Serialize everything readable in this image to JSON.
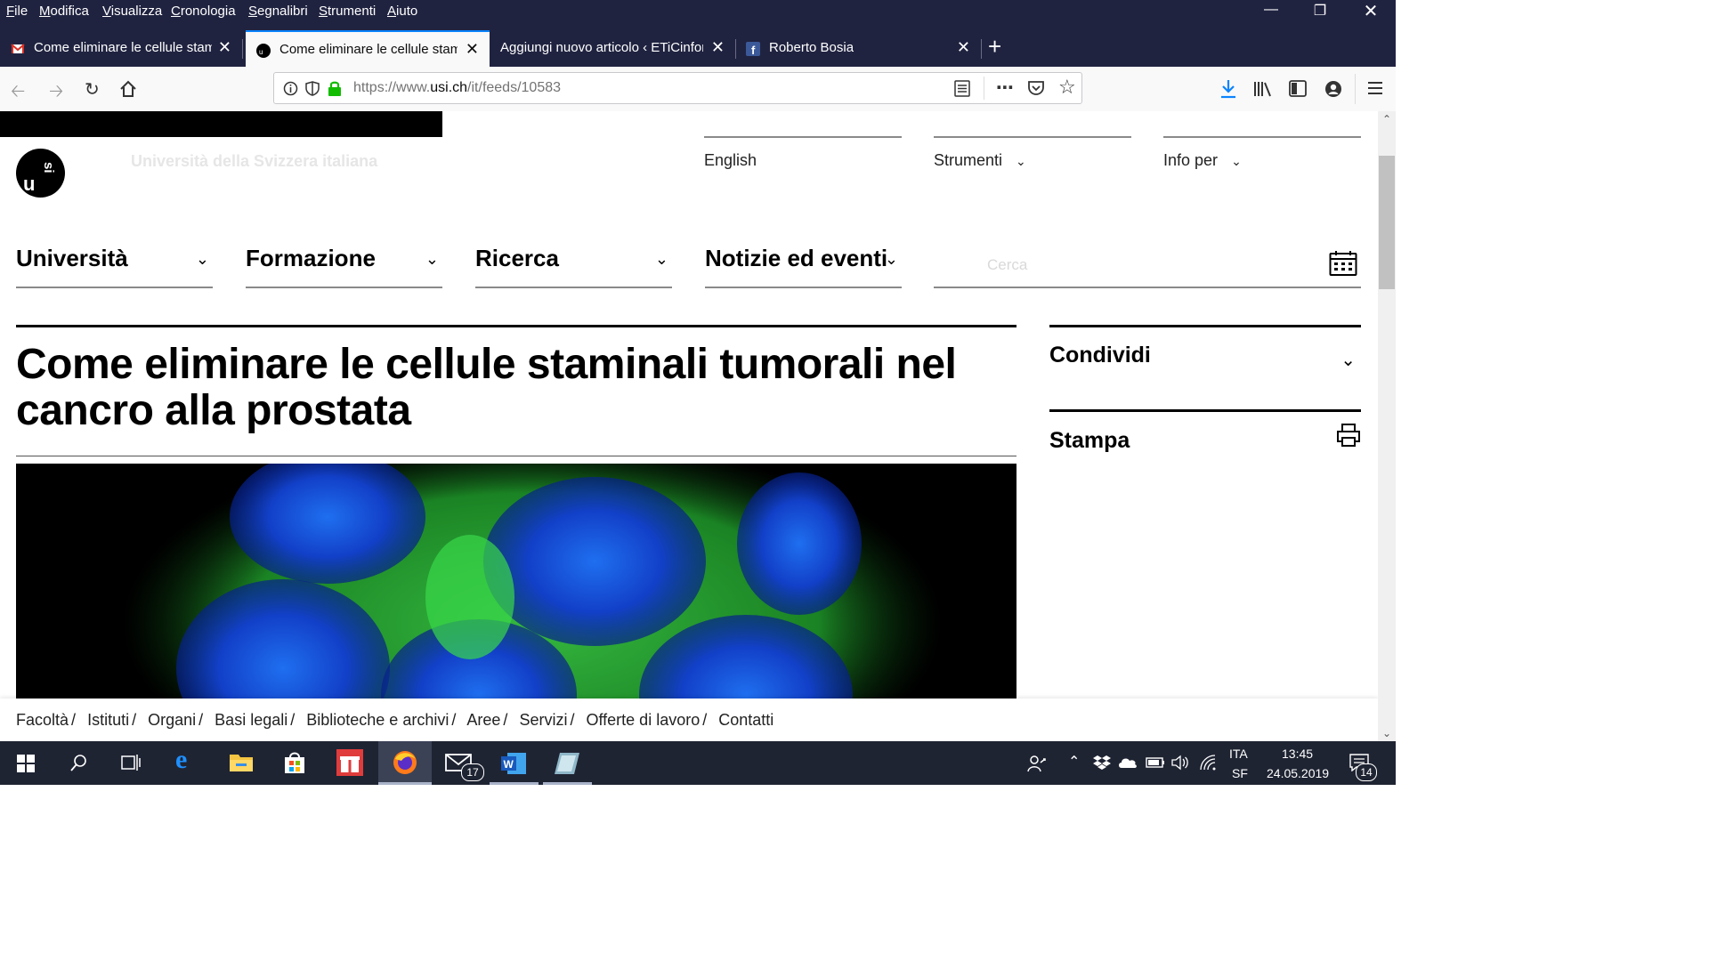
{
  "menubar": {
    "items": [
      "File",
      "Modifica",
      "Visualizza",
      "Cronologia",
      "Segnalibri",
      "Strumenti",
      "Aiuto"
    ],
    "accel": [
      "F",
      "M",
      "V",
      "C",
      "S",
      "S",
      "A"
    ]
  },
  "tabs": [
    {
      "title": "Come eliminare le cellule stami",
      "favicon": "gmail-icon",
      "active": false
    },
    {
      "title": "Come eliminare le cellule stami",
      "favicon": "usi-icon",
      "active": true
    },
    {
      "title": "Aggiungi nuovo articolo ‹ ETiCinfor",
      "favicon": "none",
      "active": false
    },
    {
      "title": "Roberto Bosia",
      "favicon": "facebook-icon",
      "active": false
    }
  ],
  "urlbar": {
    "prefix": "https://www.",
    "domain": "usi.ch",
    "path": "/it/feeds/10583"
  },
  "site": {
    "university_name": "Università della Svizzera italiana",
    "top_links": [
      {
        "label": "English",
        "has_dropdown": false
      },
      {
        "label": "Strumenti",
        "has_dropdown": true
      },
      {
        "label": "Info per",
        "has_dropdown": true
      }
    ],
    "main_nav": [
      "Università",
      "Formazione",
      "Ricerca",
      "Notizie ed eventi"
    ],
    "search_placeholder": "Cerca",
    "headline": "Come eliminare le cellule staminali tumorali nel cancro alla prostata",
    "share_label": "Condividi",
    "print_label": "Stampa",
    "footer_links": [
      "Facoltà",
      "Istituti",
      "Organi",
      "Basi legali",
      "Biblioteche e archivi",
      "Aree",
      "Servizi",
      "Offerte di lavoro",
      "Contatti"
    ]
  },
  "taskbar": {
    "mail_badge": "17",
    "lang": "ITA",
    "layout": "SF",
    "time": "13:45",
    "date": "24.05.2019",
    "notifications": "14"
  },
  "colors": {
    "chrome_dark": "#202340",
    "active_tab_accent": "#0a84ff",
    "secure_lock": "#12bc00",
    "taskbar": "#1f2433"
  }
}
